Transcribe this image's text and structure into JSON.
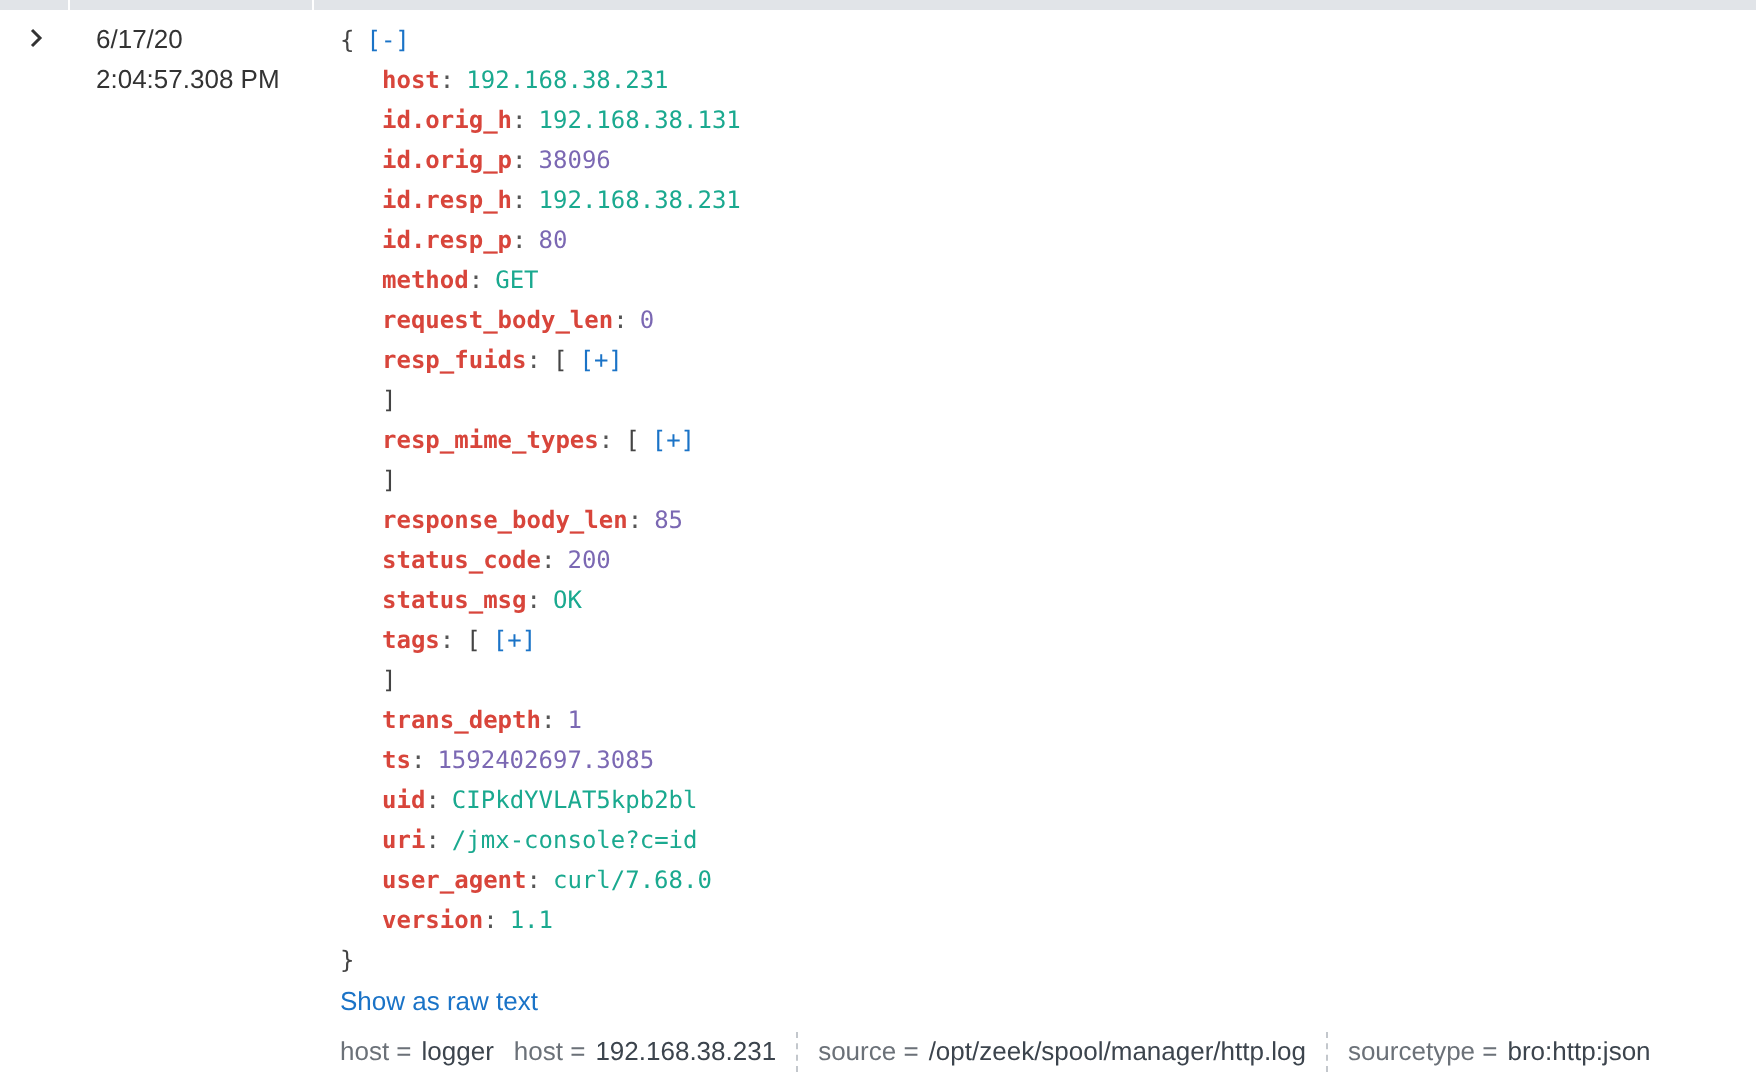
{
  "event": {
    "expanded": true,
    "date": "6/17/20",
    "time": "2:04:57.308 PM",
    "open_brace": "{",
    "collapse_toggle": "[-]",
    "close_brace": "}",
    "fields": [
      {
        "key": "host",
        "colon": ":",
        "kind": "string",
        "value": "192.168.38.231"
      },
      {
        "key": "id.orig_h",
        "colon": ":",
        "kind": "string",
        "value": "192.168.38.131"
      },
      {
        "key": "id.orig_p",
        "colon": ":",
        "kind": "number",
        "value": "38096"
      },
      {
        "key": "id.resp_h",
        "colon": ":",
        "kind": "string",
        "value": "192.168.38.231"
      },
      {
        "key": "id.resp_p",
        "colon": ":",
        "kind": "number",
        "value": "80"
      },
      {
        "key": "method",
        "colon": ":",
        "kind": "string",
        "value": "GET"
      },
      {
        "key": "request_body_len",
        "colon": ":",
        "kind": "number",
        "value": "0"
      },
      {
        "key": "resp_fuids",
        "colon": ":",
        "kind": "array",
        "open": "[",
        "toggle": "[+]",
        "close": "]"
      },
      {
        "key": "resp_mime_types",
        "colon": ":",
        "kind": "array",
        "open": "[",
        "toggle": "[+]",
        "close": "]"
      },
      {
        "key": "response_body_len",
        "colon": ":",
        "kind": "number",
        "value": "85"
      },
      {
        "key": "status_code",
        "colon": ":",
        "kind": "number",
        "value": "200"
      },
      {
        "key": "status_msg",
        "colon": ":",
        "kind": "string",
        "value": "OK"
      },
      {
        "key": "tags",
        "colon": ":",
        "kind": "array",
        "open": "[",
        "toggle": "[+]",
        "close": "]"
      },
      {
        "key": "trans_depth",
        "colon": ":",
        "kind": "number",
        "value": "1"
      },
      {
        "key": "ts",
        "colon": ":",
        "kind": "number",
        "value": "1592402697.3085"
      },
      {
        "key": "uid",
        "colon": ":",
        "kind": "string",
        "value": "CIPkdYVLAT5kpb2bl"
      },
      {
        "key": "uri",
        "colon": ":",
        "kind": "string",
        "value": "/jmx-console?c=id"
      },
      {
        "key": "user_agent",
        "colon": ":",
        "kind": "string",
        "value": "curl/7.68.0"
      },
      {
        "key": "version",
        "colon": ":",
        "kind": "string",
        "value": "1.1"
      }
    ],
    "raw_text_link": "Show as raw text",
    "metadata": [
      {
        "label": "host =",
        "values": [
          "logger"
        ]
      },
      {
        "label": "host =",
        "values": [
          "192.168.38.231"
        ],
        "divider_after": true
      },
      {
        "label": "source =",
        "values": [
          "/opt/zeek/spool/manager/http.log"
        ],
        "divider_after": true
      },
      {
        "label": "sourcetype =",
        "values": [
          "bro:http:json"
        ]
      }
    ]
  }
}
